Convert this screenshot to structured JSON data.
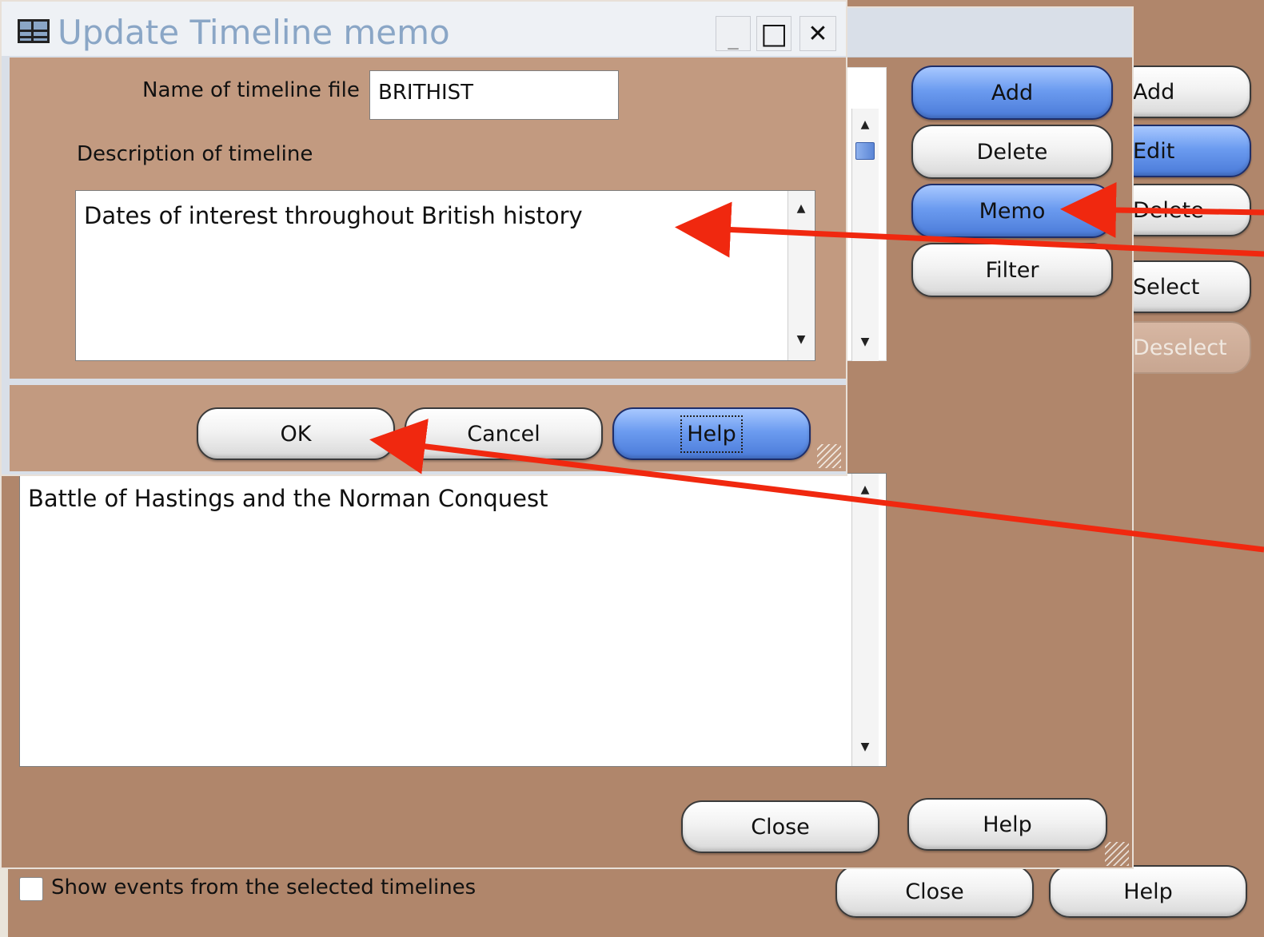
{
  "dialog": {
    "title": "Update Timeline memo",
    "name_label": "Name of timeline file",
    "name_value": "BRITHIST",
    "desc_label": "Description of timeline",
    "desc_value": "Dates of interest throughout British history",
    "ok": "OK",
    "cancel": "Cancel",
    "help": "Help",
    "minimize_glyph": "_",
    "maximize_glyph": "□",
    "close_glyph": "✕"
  },
  "middle_window": {
    "memo_text": "Battle of Hastings and the Norman Conquest",
    "buttons": {
      "add": "Add",
      "delete": "Delete",
      "memo": "Memo",
      "filter": "Filter"
    },
    "close": "Close",
    "help": "Help"
  },
  "back_window": {
    "buttons": {
      "add": "Add",
      "edit": "Edit",
      "delete": "Delete",
      "select": "Select",
      "deselect": "Deselect"
    },
    "show_events_label": "Show events from the selected timelines",
    "close": "Close",
    "help": "Help"
  },
  "glyphs": {
    "up": "▲",
    "down": "▼"
  },
  "colors": {
    "panel_brown": "#b0866b",
    "dialog_brown": "#c29a80",
    "annotation_red": "#f0280f",
    "title_blue": "#8aa6c6"
  }
}
